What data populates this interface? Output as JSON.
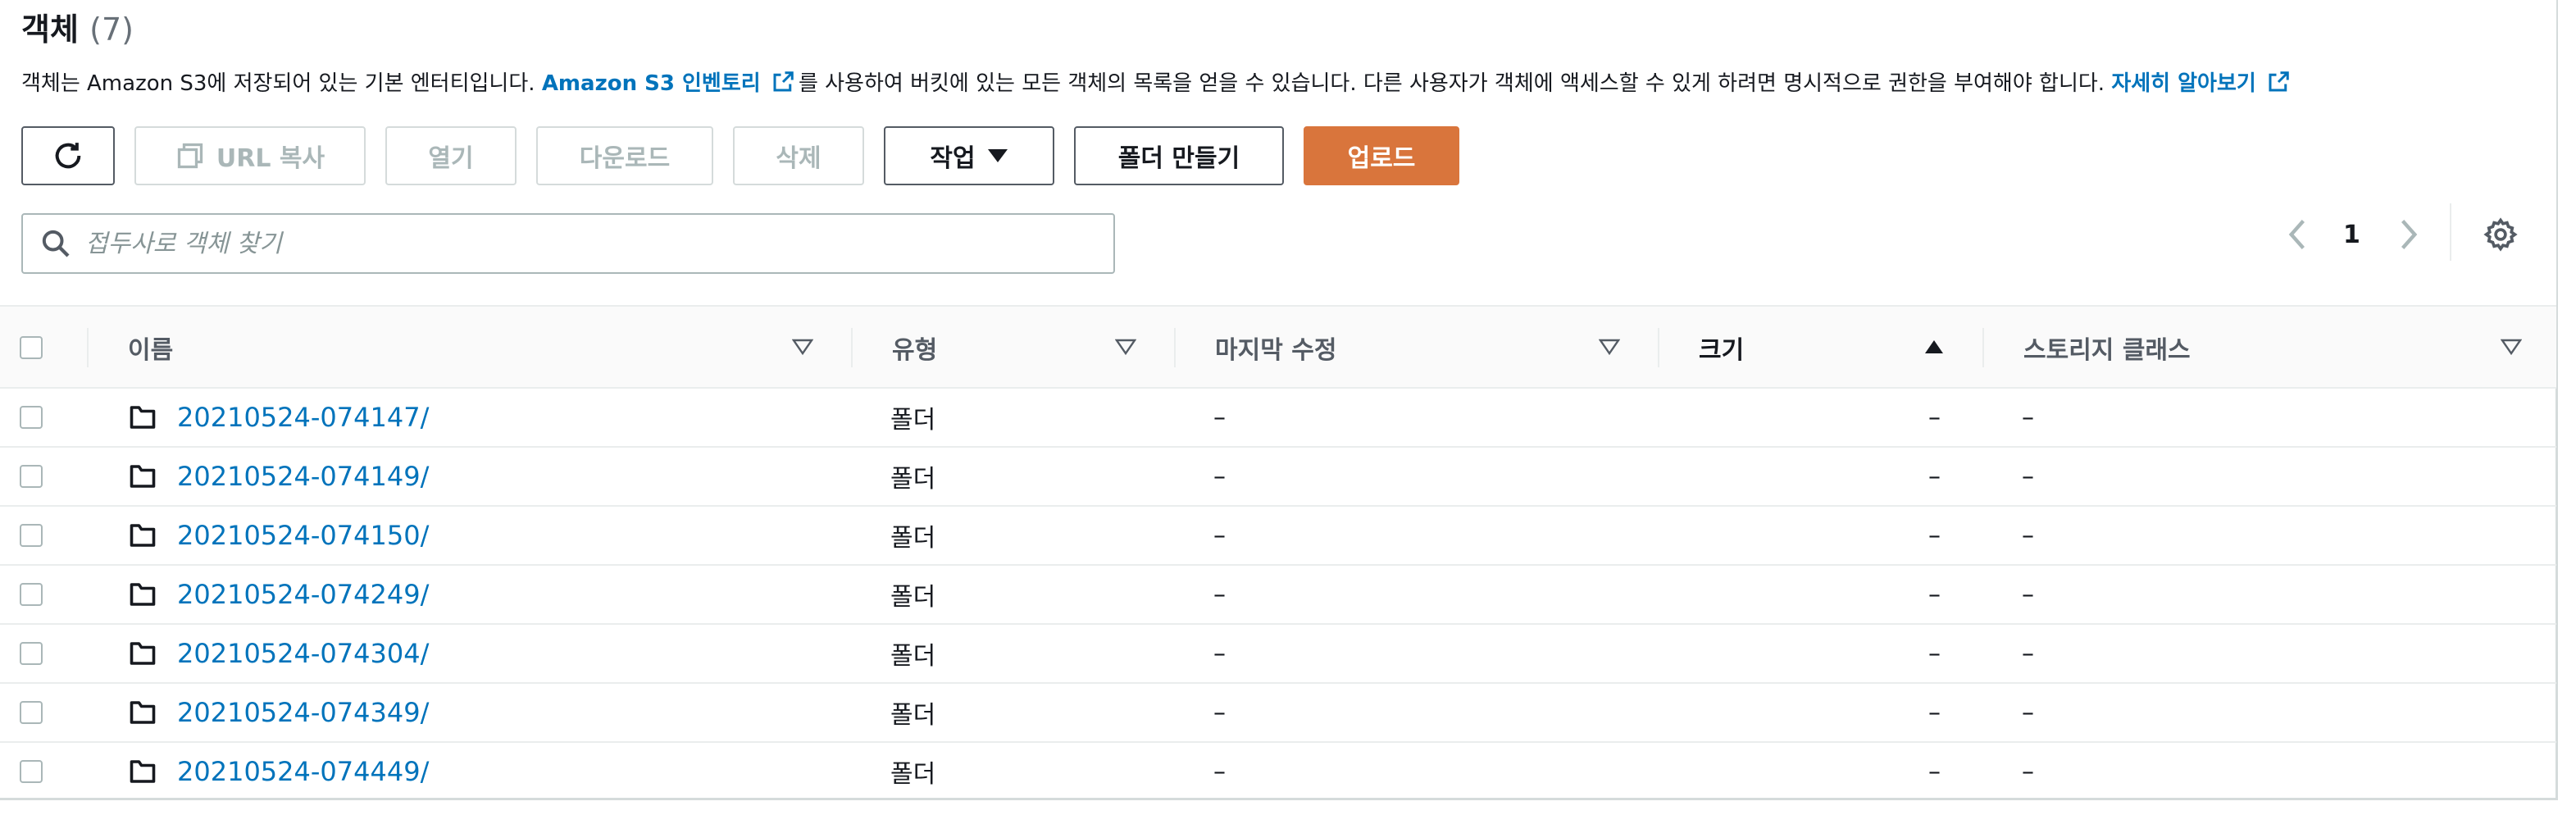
{
  "section": {
    "title": "객체",
    "count": "(7)",
    "description_part1": "객체는 Amazon S3에 저장되어 있는 기본 엔터티입니다. ",
    "inventory_link": "Amazon S3 인벤토리",
    "description_part2": "를 사용하여 버킷에 있는 모든 객체의 목록을 얻을 수 있습니다. 다른 사용자가 객체에 액세스할 수 있게 하려면 명시적으로 권한을 부여해야 합니다. ",
    "learn_more_link": "자세히 알아보기"
  },
  "toolbar": {
    "copy_url": "URL 복사",
    "open": "열기",
    "download": "다운로드",
    "delete": "삭제",
    "actions": "작업",
    "create_folder": "폴더 만들기",
    "upload": "업로드"
  },
  "search": {
    "placeholder": "접두사로 객체 찾기",
    "value": ""
  },
  "pagination": {
    "current_page": "1"
  },
  "table": {
    "columns": [
      "이름",
      "유형",
      "마지막 수정",
      "크기",
      "스토리지 클래스"
    ],
    "sorted_column": "크기",
    "rows": [
      {
        "name": "20210524-074147/",
        "type": "폴더",
        "modified": "–",
        "size": "–",
        "storage_class": "–"
      },
      {
        "name": "20210524-074149/",
        "type": "폴더",
        "modified": "–",
        "size": "–",
        "storage_class": "–"
      },
      {
        "name": "20210524-074150/",
        "type": "폴더",
        "modified": "–",
        "size": "–",
        "storage_class": "–"
      },
      {
        "name": "20210524-074249/",
        "type": "폴더",
        "modified": "–",
        "size": "–",
        "storage_class": "–"
      },
      {
        "name": "20210524-074304/",
        "type": "폴더",
        "modified": "–",
        "size": "–",
        "storage_class": "–"
      },
      {
        "name": "20210524-074349/",
        "type": "폴더",
        "modified": "–",
        "size": "–",
        "storage_class": "–"
      },
      {
        "name": "20210524-074449/",
        "type": "폴더",
        "modified": "–",
        "size": "–",
        "storage_class": "–"
      }
    ]
  },
  "colors": {
    "link": "#0073bb",
    "primary_button": "#d9753c",
    "disabled_text": "#aab7b8"
  }
}
